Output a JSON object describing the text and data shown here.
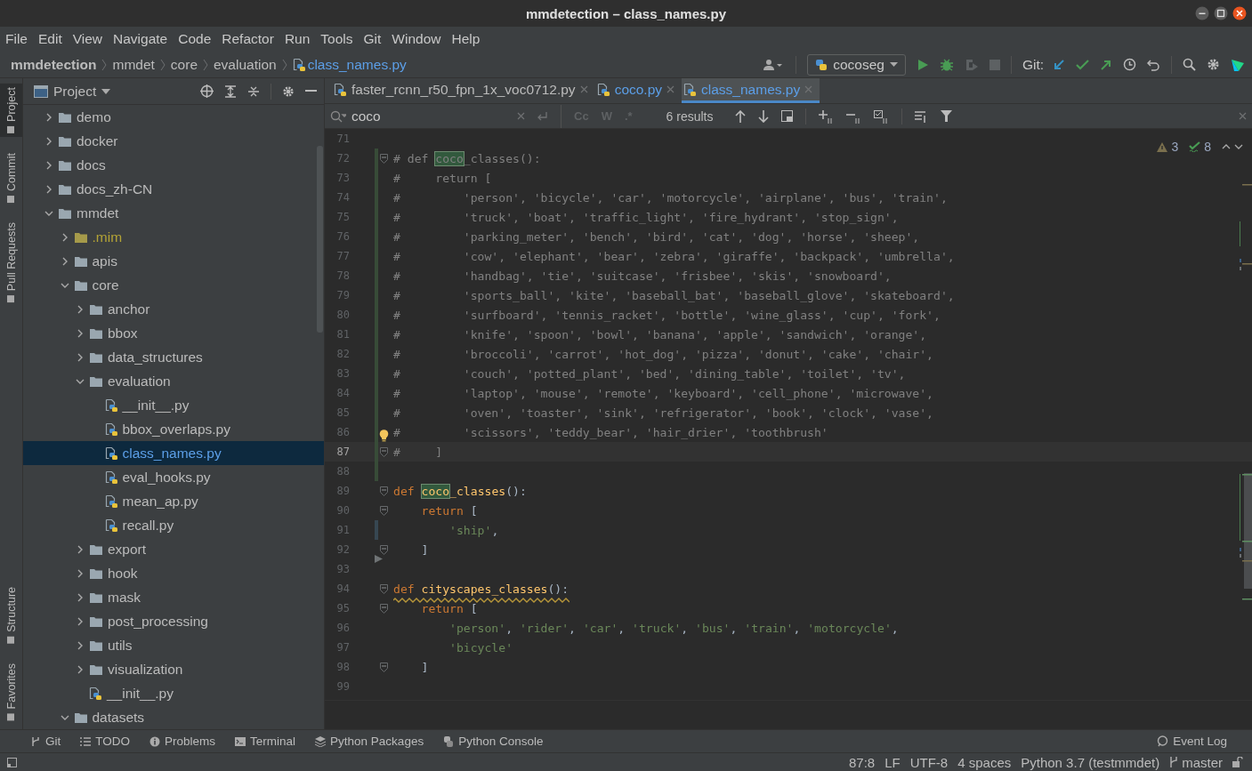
{
  "window": {
    "title": "mmdetection – class_names.py"
  },
  "menu": [
    "File",
    "Edit",
    "View",
    "Navigate",
    "Code",
    "Refactor",
    "Run",
    "Tools",
    "Git",
    "Window",
    "Help"
  ],
  "breadcrumbs": [
    {
      "label": "mmdetection",
      "kind": "project"
    },
    {
      "label": "mmdet",
      "kind": "folder"
    },
    {
      "label": "core",
      "kind": "folder"
    },
    {
      "label": "evaluation",
      "kind": "folder"
    },
    {
      "label": "class_names.py",
      "kind": "file"
    }
  ],
  "toolbar": {
    "run_config": "cocoseg",
    "git_label": "Git:"
  },
  "tool_strip": {
    "top": [
      {
        "label": "Project",
        "selected": true
      },
      {
        "label": "Commit",
        "selected": false
      },
      {
        "label": "Pull Requests",
        "selected": false
      }
    ],
    "bottom": [
      {
        "label": "Structure",
        "selected": false
      },
      {
        "label": "Favorites",
        "selected": false
      }
    ]
  },
  "project": {
    "title": "Project",
    "tree": [
      {
        "name": "demo",
        "kind": "folder",
        "modified": false,
        "ignored": false,
        "expanded": false,
        "selected": false
      },
      {
        "name": "docker",
        "kind": "folder",
        "modified": false,
        "ignored": false,
        "expanded": false,
        "selected": false
      },
      {
        "name": "docs",
        "kind": "folder",
        "modified": false,
        "ignored": false,
        "expanded": false,
        "selected": false
      },
      {
        "name": "docs_zh-CN",
        "kind": "folder",
        "modified": false,
        "ignored": false,
        "expanded": false,
        "selected": false
      },
      {
        "name": "mmdet",
        "kind": "folder",
        "modified": false,
        "ignored": false,
        "expanded": true,
        "selected": false,
        "children": [
          {
            "name": ".mim",
            "kind": "folder",
            "modified": false,
            "ignored": true,
            "expanded": false,
            "selected": false
          },
          {
            "name": "apis",
            "kind": "folder",
            "modified": false,
            "ignored": false,
            "expanded": false,
            "selected": false
          },
          {
            "name": "core",
            "kind": "folder",
            "modified": false,
            "ignored": false,
            "expanded": true,
            "selected": false,
            "children": [
              {
                "name": "anchor",
                "kind": "folder",
                "modified": false,
                "ignored": false,
                "expanded": false,
                "selected": false
              },
              {
                "name": "bbox",
                "kind": "folder",
                "modified": false,
                "ignored": false,
                "expanded": false,
                "selected": false
              },
              {
                "name": "data_structures",
                "kind": "folder",
                "modified": false,
                "ignored": false,
                "expanded": false,
                "selected": false
              },
              {
                "name": "evaluation",
                "kind": "folder",
                "modified": false,
                "ignored": false,
                "expanded": true,
                "selected": false,
                "children": [
                  {
                    "name": "__init__.py",
                    "kind": "python",
                    "modified": false,
                    "ignored": false,
                    "selected": false
                  },
                  {
                    "name": "bbox_overlaps.py",
                    "kind": "python",
                    "modified": false,
                    "ignored": false,
                    "selected": false
                  },
                  {
                    "name": "class_names.py",
                    "kind": "python",
                    "modified": true,
                    "ignored": false,
                    "selected": true
                  },
                  {
                    "name": "eval_hooks.py",
                    "kind": "python",
                    "modified": false,
                    "ignored": false,
                    "selected": false
                  },
                  {
                    "name": "mean_ap.py",
                    "kind": "python",
                    "modified": false,
                    "ignored": false,
                    "selected": false
                  },
                  {
                    "name": "recall.py",
                    "kind": "python",
                    "modified": false,
                    "ignored": false,
                    "selected": false
                  }
                ]
              },
              {
                "name": "export",
                "kind": "folder",
                "modified": false,
                "ignored": false,
                "expanded": false,
                "selected": false
              },
              {
                "name": "hook",
                "kind": "folder",
                "modified": false,
                "ignored": false,
                "expanded": false,
                "selected": false
              },
              {
                "name": "mask",
                "kind": "folder",
                "modified": false,
                "ignored": false,
                "expanded": false,
                "selected": false
              },
              {
                "name": "post_processing",
                "kind": "folder",
                "modified": false,
                "ignored": false,
                "expanded": false,
                "selected": false
              },
              {
                "name": "utils",
                "kind": "folder",
                "modified": false,
                "ignored": false,
                "expanded": false,
                "selected": false
              },
              {
                "name": "visualization",
                "kind": "folder",
                "modified": false,
                "ignored": false,
                "expanded": false,
                "selected": false
              },
              {
                "name": "__init__.py",
                "kind": "python",
                "modified": false,
                "ignored": false,
                "selected": false
              }
            ]
          },
          {
            "name": "datasets",
            "kind": "folder",
            "modified": false,
            "ignored": false,
            "expanded": true,
            "selected": false
          }
        ]
      }
    ]
  },
  "tabs": [
    {
      "label": "faster_rcnn_r50_fpn_1x_voc0712.py",
      "modified": false,
      "selected": false
    },
    {
      "label": "coco.py",
      "modified": true,
      "selected": false
    },
    {
      "label": "class_names.py",
      "modified": true,
      "selected": true
    }
  ],
  "search": {
    "query": "coco",
    "options": [
      {
        "label": "Cc",
        "on": false
      },
      {
        "label": "W",
        "on": false
      },
      {
        "label": ".*",
        "on": false
      }
    ],
    "results": "6 results"
  },
  "inspections": {
    "warnings": "3",
    "weak_warnings": "8"
  },
  "editor": {
    "lines": [
      {
        "number": "71",
        "kind": "unchanged",
        "fold": false,
        "current": false,
        "warning": false,
        "bulb": false
      },
      {
        "number": "72",
        "kind": "added",
        "fold": true,
        "current": false,
        "warning": false,
        "bulb": false,
        "tokens": [
          {
            "kind": "comment",
            "text": "# def "
          },
          {
            "kind": "comment-match",
            "text": "coco"
          },
          {
            "kind": "comment",
            "text": "_classes():"
          }
        ]
      },
      {
        "number": "73",
        "kind": "added",
        "fold": false,
        "current": false,
        "warning": false,
        "bulb": false,
        "tokens": [
          {
            "kind": "comment",
            "text": "#     return ["
          }
        ]
      },
      {
        "number": "74",
        "kind": "added",
        "fold": false,
        "current": false,
        "warning": false,
        "bulb": false,
        "tokens": [
          {
            "kind": "comment",
            "text": "#         'person', 'bicycle', 'car', 'motorcycle', 'airplane', 'bus', 'train',"
          }
        ]
      },
      {
        "number": "75",
        "kind": "added",
        "fold": false,
        "current": false,
        "warning": false,
        "bulb": false,
        "tokens": [
          {
            "kind": "comment",
            "text": "#         'truck', 'boat', 'traffic_light', 'fire_hydrant', 'stop_sign',"
          }
        ]
      },
      {
        "number": "76",
        "kind": "added",
        "fold": false,
        "current": false,
        "warning": false,
        "bulb": false,
        "tokens": [
          {
            "kind": "comment",
            "text": "#         'parking_meter', 'bench', 'bird', 'cat', 'dog', 'horse', 'sheep',"
          }
        ]
      },
      {
        "number": "77",
        "kind": "added",
        "fold": false,
        "current": false,
        "warning": false,
        "bulb": false,
        "tokens": [
          {
            "kind": "comment",
            "text": "#         'cow', 'elephant', 'bear', 'zebra', 'giraffe', 'backpack', 'umbrella',"
          }
        ]
      },
      {
        "number": "78",
        "kind": "added",
        "fold": false,
        "current": false,
        "warning": false,
        "bulb": false,
        "tokens": [
          {
            "kind": "comment",
            "text": "#         'handbag', 'tie', 'suitcase', 'frisbee', 'skis', 'snowboard',"
          }
        ]
      },
      {
        "number": "79",
        "kind": "added",
        "fold": false,
        "current": false,
        "warning": false,
        "bulb": false,
        "tokens": [
          {
            "kind": "comment",
            "text": "#         'sports_ball', 'kite', 'baseball_bat', 'baseball_glove', 'skateboard',"
          }
        ]
      },
      {
        "number": "80",
        "kind": "added",
        "fold": false,
        "current": false,
        "warning": false,
        "bulb": false,
        "tokens": [
          {
            "kind": "comment",
            "text": "#         'surfboard', 'tennis_racket', 'bottle', 'wine_glass', 'cup', 'fork',"
          }
        ]
      },
      {
        "number": "81",
        "kind": "added",
        "fold": false,
        "current": false,
        "warning": false,
        "bulb": false,
        "tokens": [
          {
            "kind": "comment",
            "text": "#         'knife', 'spoon', 'bowl', 'banana', 'apple', 'sandwich', 'orange',"
          }
        ]
      },
      {
        "number": "82",
        "kind": "added",
        "fold": false,
        "current": false,
        "warning": false,
        "bulb": false,
        "tokens": [
          {
            "kind": "comment",
            "text": "#         'broccoli', 'carrot', 'hot_dog', 'pizza', 'donut', 'cake', 'chair',"
          }
        ]
      },
      {
        "number": "83",
        "kind": "added",
        "fold": false,
        "current": false,
        "warning": false,
        "bulb": false,
        "tokens": [
          {
            "kind": "comment",
            "text": "#         'couch', 'potted_plant', 'bed', 'dining_table', 'toilet', 'tv',"
          }
        ]
      },
      {
        "number": "84",
        "kind": "added",
        "fold": false,
        "current": false,
        "warning": false,
        "bulb": false,
        "tokens": [
          {
            "kind": "comment",
            "text": "#         'laptop', 'mouse', 'remote', 'keyboard', 'cell_phone', 'microwave',"
          }
        ]
      },
      {
        "number": "85",
        "kind": "added",
        "fold": false,
        "current": false,
        "warning": false,
        "bulb": false,
        "tokens": [
          {
            "kind": "comment",
            "text": "#         'oven', 'toaster', 'sink', 'refrigerator', 'book', 'clock', 'vase',"
          }
        ]
      },
      {
        "number": "86",
        "kind": "added",
        "fold": false,
        "current": false,
        "warning": false,
        "bulb": true,
        "tokens": [
          {
            "kind": "comment",
            "text": "#         'scissors', 'teddy_bear', 'hair_drier', 'toothbrush'"
          }
        ]
      },
      {
        "number": "87",
        "kind": "added",
        "fold": true,
        "current": true,
        "warning": false,
        "bulb": false,
        "tokens": [
          {
            "kind": "comment",
            "text": "#     ]"
          }
        ]
      },
      {
        "number": "88",
        "kind": "added",
        "fold": false,
        "current": false,
        "warning": false,
        "bulb": false
      },
      {
        "number": "89",
        "kind": "unchanged",
        "fold": true,
        "current": false,
        "warning": false,
        "bulb": false,
        "tokens": [
          {
            "kind": "keyword",
            "text": "def "
          },
          {
            "kind": "function-match",
            "text": "coco"
          },
          {
            "kind": "function",
            "text": "_classes"
          },
          {
            "kind": "plain",
            "text": "():"
          }
        ]
      },
      {
        "number": "90",
        "kind": "unchanged",
        "fold": true,
        "current": false,
        "warning": false,
        "bulb": false,
        "tokens": [
          {
            "kind": "keyword",
            "text": "    return"
          },
          {
            "kind": "plain",
            "text": " ["
          }
        ]
      },
      {
        "number": "91",
        "kind": "modified",
        "fold": false,
        "current": false,
        "warning": false,
        "bulb": false,
        "tokens": [
          {
            "kind": "string",
            "text": "        'ship'"
          },
          {
            "kind": "plain",
            "text": ","
          }
        ]
      },
      {
        "number": "92",
        "kind": "unchanged",
        "fold": true,
        "current": false,
        "warning": false,
        "bulb": false,
        "tokens": [
          {
            "kind": "plain",
            "text": "    ]"
          }
        ]
      },
      {
        "number": "93",
        "kind": "deleted",
        "fold": false,
        "current": false,
        "warning": false,
        "bulb": false
      },
      {
        "number": "94",
        "kind": "unchanged",
        "fold": true,
        "current": false,
        "warning": true,
        "bulb": false,
        "tokens": [
          {
            "kind": "keyword",
            "text": "def "
          },
          {
            "kind": "function",
            "text": "cityscapes_classes"
          },
          {
            "kind": "plain",
            "text": "():"
          }
        ]
      },
      {
        "number": "95",
        "kind": "unchanged",
        "fold": true,
        "current": false,
        "warning": false,
        "bulb": false,
        "tokens": [
          {
            "kind": "keyword",
            "text": "    return"
          },
          {
            "kind": "plain",
            "text": " ["
          }
        ]
      },
      {
        "number": "96",
        "kind": "unchanged",
        "fold": false,
        "current": false,
        "warning": false,
        "bulb": false,
        "tokens": [
          {
            "kind": "string",
            "text": "        'person'"
          },
          {
            "kind": "plain",
            "text": ", "
          },
          {
            "kind": "string",
            "text": "'rider'"
          },
          {
            "kind": "plain",
            "text": ", "
          },
          {
            "kind": "string",
            "text": "'car'"
          },
          {
            "kind": "plain",
            "text": ", "
          },
          {
            "kind": "string",
            "text": "'truck'"
          },
          {
            "kind": "plain",
            "text": ", "
          },
          {
            "kind": "string",
            "text": "'bus'"
          },
          {
            "kind": "plain",
            "text": ", "
          },
          {
            "kind": "string",
            "text": "'train'"
          },
          {
            "kind": "plain",
            "text": ", "
          },
          {
            "kind": "string",
            "text": "'motorcycle'"
          },
          {
            "kind": "plain",
            "text": ","
          }
        ]
      },
      {
        "number": "97",
        "kind": "unchanged",
        "fold": false,
        "current": false,
        "warning": false,
        "bulb": false,
        "tokens": [
          {
            "kind": "string",
            "text": "        'bicycle'"
          }
        ]
      },
      {
        "number": "98",
        "kind": "unchanged",
        "fold": true,
        "current": false,
        "warning": false,
        "bulb": false,
        "tokens": [
          {
            "kind": "plain",
            "text": "    ]"
          }
        ]
      },
      {
        "number": "99",
        "kind": "unchanged",
        "fold": false,
        "current": false,
        "warning": false,
        "bulb": false
      }
    ]
  },
  "bottom_bar": {
    "left": [
      "Git",
      "TODO",
      "Problems",
      "Terminal",
      "Python Packages",
      "Python Console"
    ],
    "right": [
      "Event Log"
    ]
  },
  "status_bar": {
    "items": [
      "87:8",
      "LF",
      "UTF-8",
      "4 spaces",
      "Python 3.7 (testmmdet)"
    ],
    "branch": "master"
  }
}
